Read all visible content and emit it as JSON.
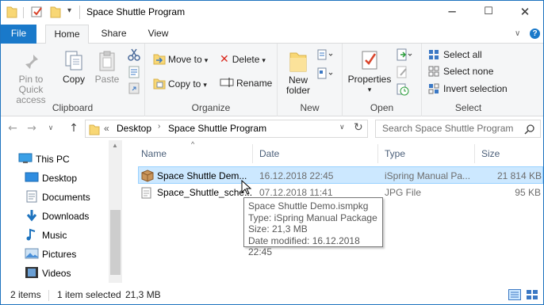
{
  "window": {
    "title": "Space Shuttle Program",
    "controls": {
      "minimize": "─",
      "maximize": "☐",
      "close": "✕"
    }
  },
  "ribbon_tabs": [
    {
      "label": "File",
      "active": false
    },
    {
      "label": "Home",
      "active": true
    },
    {
      "label": "Share",
      "active": false
    },
    {
      "label": "View",
      "active": false
    }
  ],
  "ribbon": {
    "clipboard": {
      "label": "Clipboard",
      "pin_to_quick_access": "Pin to Quick access",
      "copy": "Copy",
      "paste": "Paste"
    },
    "organize": {
      "label": "Organize",
      "move_to": "Move to",
      "copy_to": "Copy to",
      "delete": "Delete",
      "rename": "Rename"
    },
    "new": {
      "label": "New",
      "new_folder": "New folder"
    },
    "open": {
      "label": "Open",
      "properties": "Properties"
    },
    "select": {
      "label": "Select",
      "select_all": "Select all",
      "select_none": "Select none",
      "invert_selection": "Invert selection"
    }
  },
  "address": {
    "prefix": "«",
    "crumbs": [
      "Desktop",
      "Space Shuttle Program"
    ],
    "search_placeholder": "Search Space Shuttle Program"
  },
  "nav_pane": [
    {
      "label": "This PC",
      "icon": "pc-icon"
    },
    {
      "label": "Desktop",
      "icon": "desktop-icon"
    },
    {
      "label": "Documents",
      "icon": "documents-icon"
    },
    {
      "label": "Downloads",
      "icon": "downloads-icon"
    },
    {
      "label": "Music",
      "icon": "music-icon"
    },
    {
      "label": "Pictures",
      "icon": "pictures-icon"
    },
    {
      "label": "Videos",
      "icon": "videos-icon"
    }
  ],
  "columns": {
    "name": "Name",
    "date": "Date",
    "type": "Type",
    "size": "Size"
  },
  "files": [
    {
      "name": "Space Shuttle Dem...",
      "date": "16.12.2018 22:45",
      "type": "iSpring Manual Pa...",
      "size": "21 814 KB",
      "selected": true
    },
    {
      "name": "Space_Shuttle_sche...",
      "date": "07.12.2018 11:41",
      "type": "JPG File",
      "size": "95 KB",
      "selected": false
    }
  ],
  "tooltip": [
    "Space Shuttle Demo.ismpkg",
    "Type: iSpring Manual Package",
    "Size: 21,3 MB",
    "Date modified: 16.12.2018 22:45"
  ],
  "status": {
    "items_count": "2 items",
    "selected": "1 item selected",
    "selected_size": "21,3 MB"
  },
  "colors": {
    "accent": "#1979ca",
    "selection": "#cce8ff",
    "folder": "#f8d775"
  }
}
